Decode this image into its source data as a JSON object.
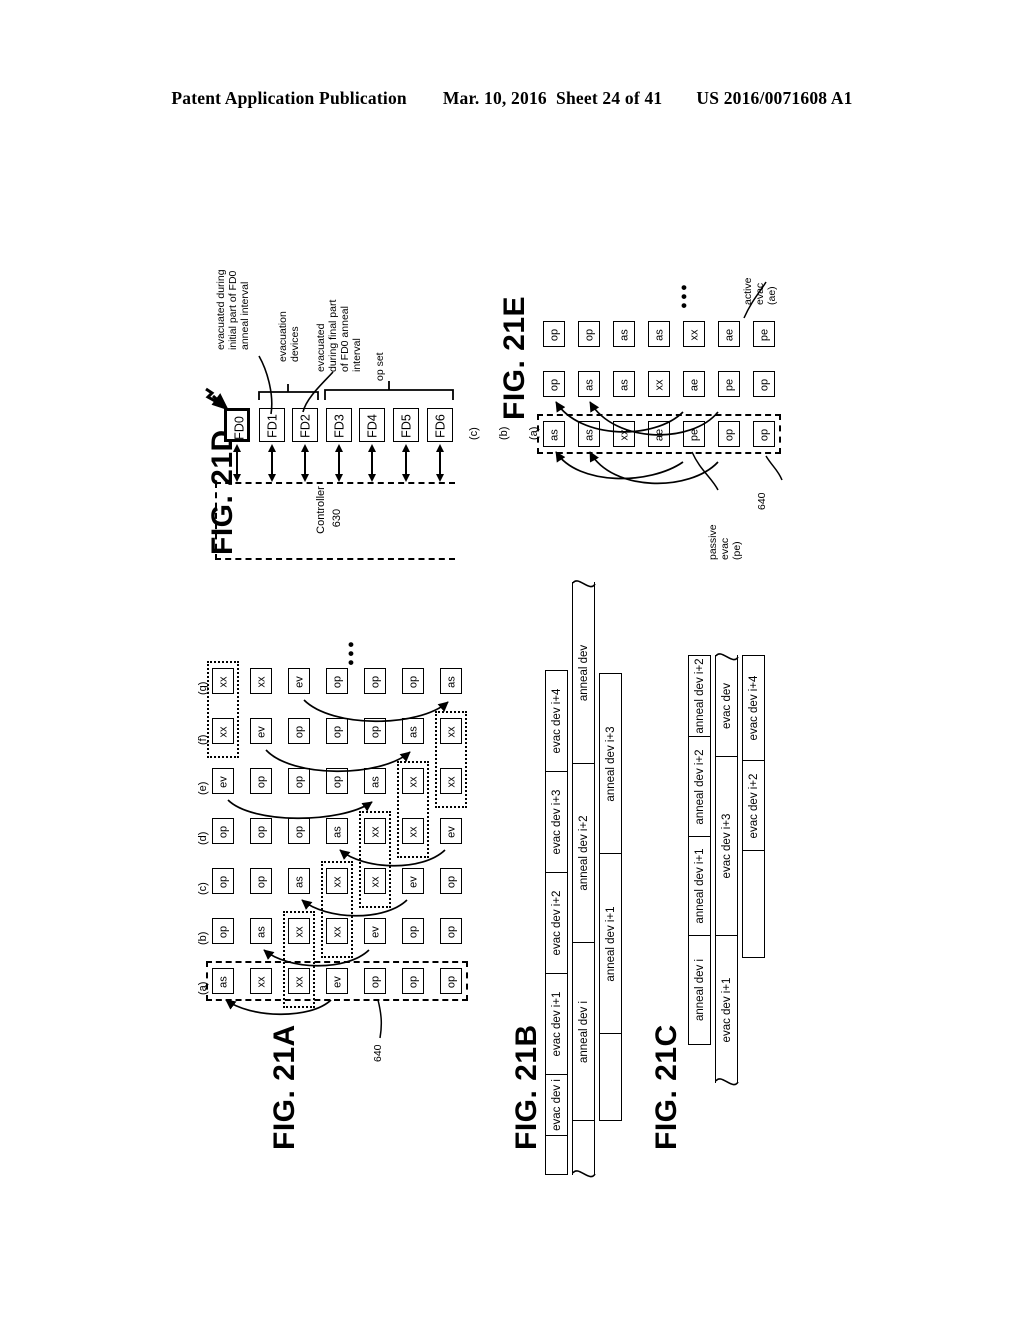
{
  "header": {
    "publication": "Patent Application Publication",
    "date": "Mar. 10, 2016",
    "sheet": "Sheet 24 of 41",
    "number": "US 2016/0071608 A1"
  },
  "figures": {
    "fig21a": {
      "title": "FIG. 21A",
      "column_labels": [
        "(a)",
        "(b)",
        "(c)",
        "(d)",
        "(e)",
        "(f)",
        "(g)"
      ],
      "columns": [
        [
          "as",
          "xx",
          "xx",
          "ev",
          "op",
          "op",
          "op"
        ],
        [
          "op",
          "as",
          "xx",
          "xx",
          "ev",
          "op",
          "op"
        ],
        [
          "op",
          "op",
          "as",
          "xx",
          "xx",
          "ev",
          "op"
        ],
        [
          "op",
          "op",
          "op",
          "as",
          "xx",
          "xx",
          "ev"
        ],
        [
          "ev",
          "op",
          "op",
          "op",
          "as",
          "xx",
          "xx"
        ],
        [
          "xx",
          "ev",
          "op",
          "op",
          "op",
          "as",
          "xx"
        ],
        [
          "xx",
          "xx",
          "ev",
          "op",
          "op",
          "op",
          "as"
        ]
      ],
      "reference_numeral": "640",
      "ellipsis": "•••"
    },
    "fig21b": {
      "title": "FIG. 21B",
      "rows": [
        {
          "name": "evac-row",
          "cells": [
            "evac dev i",
            "evac dev i+1",
            "evac dev i+2",
            "evac dev i+3",
            "evac dev i+4"
          ]
        },
        {
          "name": "anneal-row-1",
          "cells": [
            "anneal dev i",
            "anneal dev i+2",
            "anneal dev"
          ]
        },
        {
          "name": "anneal-row-2",
          "cells": [
            "anneal dev i+1",
            "anneal dev i+3"
          ]
        }
      ]
    },
    "fig21c": {
      "title": "FIG. 21C",
      "rows": [
        {
          "name": "anneal-row",
          "cells": [
            "anneal dev i",
            "anneal dev i+1",
            "anneal dev i+2",
            "anneal dev i+2"
          ]
        },
        {
          "name": "evac-row-1",
          "cells": [
            "evac dev i+1",
            "evac dev i+3",
            "evac dev"
          ]
        },
        {
          "name": "evac-row-2",
          "cells": [
            "evac dev i+2",
            "evac dev i+4"
          ]
        }
      ]
    },
    "fig21d": {
      "title": "FIG. 21D",
      "devices": [
        "FD0",
        "FD1",
        "FD2",
        "FD3",
        "FD4",
        "FD5",
        "FD6"
      ],
      "controller_label": "Controller",
      "controller_numeral": "630",
      "annotations": {
        "initial": "evacuated during\ninitial part of FD0\nanneal interval",
        "evacuation_devices": "evacuation\ndevices",
        "final": "evacuated\nduring final part\nof FD0 anneal\ninterval",
        "op_set": "op set"
      }
    },
    "fig21e": {
      "title": "FIG. 21E",
      "column_labels": [
        "(a)",
        "(b)",
        "(c)"
      ],
      "columns": [
        [
          "as",
          "as",
          "xx",
          "ae",
          "pe",
          "op",
          "op"
        ],
        [
          "op",
          "as",
          "as",
          "xx",
          "ae",
          "pe",
          "op"
        ],
        [
          "op",
          "op",
          "as",
          "as",
          "xx",
          "ae",
          "pe"
        ]
      ],
      "reference_numeral": "640",
      "annotations": {
        "passive": "passive\nevac\n(pe)",
        "active": "active\nevac\n(ae)"
      },
      "ellipsis": "•••"
    }
  }
}
